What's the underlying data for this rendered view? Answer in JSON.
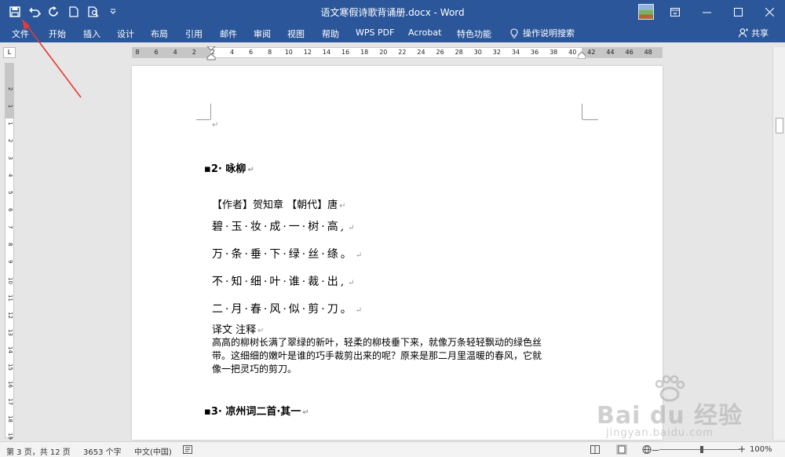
{
  "app": {
    "title": "语文寒假诗歌背诵册.docx - Word",
    "colors": {
      "ribbon": "#2b579a",
      "workspace": "#e6e6e6",
      "annotation": "#e53935"
    }
  },
  "quick_access": {
    "icons": [
      "save-icon",
      "undo-icon",
      "redo-icon",
      "new-document-icon",
      "print-preview-icon",
      "customize-dropdown-icon"
    ]
  },
  "window_controls": [
    "ribbon-display-icon",
    "minimize-icon",
    "maximize-icon",
    "close-icon"
  ],
  "ribbon": {
    "tabs": [
      "文件",
      "开始",
      "插入",
      "设计",
      "布局",
      "引用",
      "邮件",
      "审阅",
      "视图",
      "帮助",
      "WPS PDF",
      "Acrobat",
      "特色功能"
    ],
    "tell_me": "操作说明搜索",
    "share": "共享"
  },
  "rulers": {
    "corner": "L",
    "horizontal_ticks": [
      "8",
      "6",
      "4",
      "2",
      "2",
      "4",
      "6",
      "8",
      "10",
      "12",
      "14",
      "16",
      "18",
      "20",
      "22",
      "24",
      "26",
      "28",
      "30",
      "32",
      "34",
      "36",
      "38",
      "40",
      "42",
      "44",
      "46",
      "48"
    ],
    "vertical_ticks": [
      "2",
      "1",
      "1",
      "2",
      "3",
      "4",
      "5",
      "6",
      "7",
      "8",
      "9",
      "10",
      "11",
      "12",
      "13",
      "14",
      "15",
      "16",
      "17",
      "18",
      "19"
    ]
  },
  "document": {
    "empty_mark": "↵",
    "section2": {
      "heading": "2· 咏柳",
      "author_line": "【作者】贺知章 【朝代】唐",
      "lines": [
        "碧·玉·妆·成·一·树·高,",
        "万·条·垂·下·绿·丝·绦。",
        "不·知·细·叶·谁·裁·出,",
        "二·月·春·风·似·剪·刀。"
      ],
      "translation_label": "译文 注释",
      "translation_lines": [
        "高高的柳树长满了翠绿的新叶，轻柔的柳枝垂下来，就像万条轻轻飘动的绿色丝",
        "带。这细细的嫩叶是谁的巧手裁剪出来的呢？原来是那二月里温暖的春风，它就",
        "像一把灵巧的剪刀。"
      ]
    },
    "section3": {
      "heading": "3· 凉州词二首·其一"
    }
  },
  "status": {
    "page": "第 3 页，共 12 页",
    "words": "3653 个字",
    "language": "中文(中国)",
    "zoom": "100%",
    "zoom_minus": "－",
    "zoom_plus": "+"
  },
  "watermark": {
    "brand": "Bai du 经验",
    "url": "jingyan.baidu.com"
  }
}
